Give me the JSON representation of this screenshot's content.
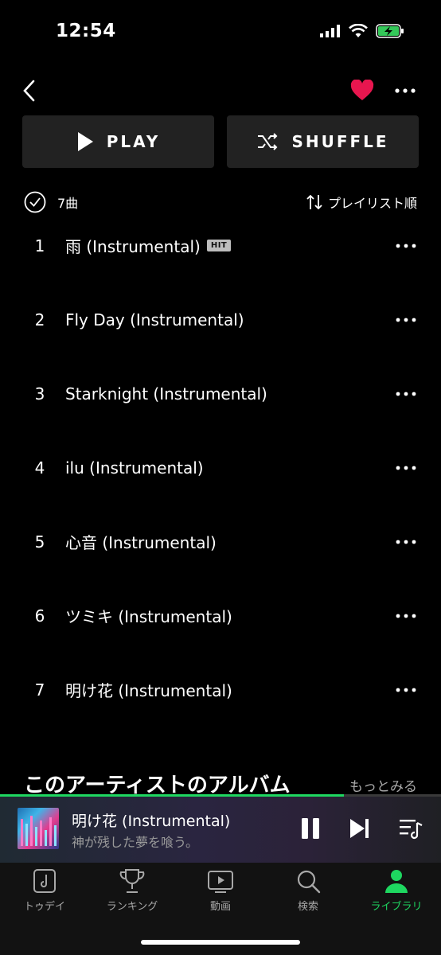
{
  "status_bar": {
    "time": "12:54"
  },
  "actions": {
    "play_label": "PLAY",
    "shuffle_label": "SHUFFLE"
  },
  "list_meta": {
    "count": "7曲",
    "sort": "プレイリスト順"
  },
  "tracks": [
    {
      "num": "1",
      "title": "雨 (Instrumental)",
      "badge": "HIT"
    },
    {
      "num": "2",
      "title": "Fly Day (Instrumental)"
    },
    {
      "num": "3",
      "title": "Starknight (Instrumental)"
    },
    {
      "num": "4",
      "title": "ilu (Instrumental)"
    },
    {
      "num": "5",
      "title": "心音 (Instrumental)"
    },
    {
      "num": "6",
      "title": "ツミキ (Instrumental)"
    },
    {
      "num": "7",
      "title": "明け花 (Instrumental)"
    }
  ],
  "albums_section": {
    "title": "このアーティストのアルバム",
    "more": "もっとみる"
  },
  "now_playing": {
    "title": "明け花 (Instrumental)",
    "subtitle": "神が残した夢を喰う。",
    "progress": 0.78
  },
  "bottom_nav": [
    {
      "label": "トゥデイ",
      "icon": "music-note-icon"
    },
    {
      "label": "ランキング",
      "icon": "trophy-icon"
    },
    {
      "label": "動画",
      "icon": "video-play-icon"
    },
    {
      "label": "検索",
      "icon": "search-icon"
    },
    {
      "label": "ライブラリ",
      "icon": "person-icon",
      "active": true
    }
  ],
  "colors": {
    "accent": "#1ed760",
    "heart": "#e8164f",
    "background": "#000000"
  }
}
